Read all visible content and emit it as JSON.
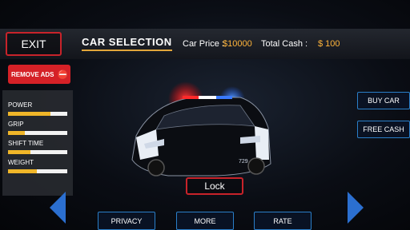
{
  "header": {
    "exit_label": "EXIT",
    "title": "CAR SELECTION",
    "car_price_label": "Car Price :",
    "car_price_value": "$10000",
    "total_cash_label": "Total Cash :",
    "total_cash_value": "$ 100"
  },
  "remove_ads": {
    "label": "REMOVE ADS",
    "icon": "no-ads-icon"
  },
  "stats": [
    {
      "label": "POWER",
      "level": 0.72
    },
    {
      "label": "GRIP",
      "level": 0.28
    },
    {
      "label": "SHIFT TIME",
      "level": 0.38
    },
    {
      "label": "WEIGHT",
      "level": 0.48
    }
  ],
  "car": {
    "plate": "729",
    "icon": "police-car-image"
  },
  "actions": {
    "buy_car": "BUY CAR",
    "free_cash": "FREE CASH",
    "lock": "Lock",
    "privacy": "PRIVACY",
    "more": "MORE",
    "rate": "RATE"
  },
  "colors": {
    "accent_red": "#c8232a",
    "accent_blue": "#2a7fc9",
    "stat_fill": "#f0b629",
    "price": "#ffb43a"
  }
}
